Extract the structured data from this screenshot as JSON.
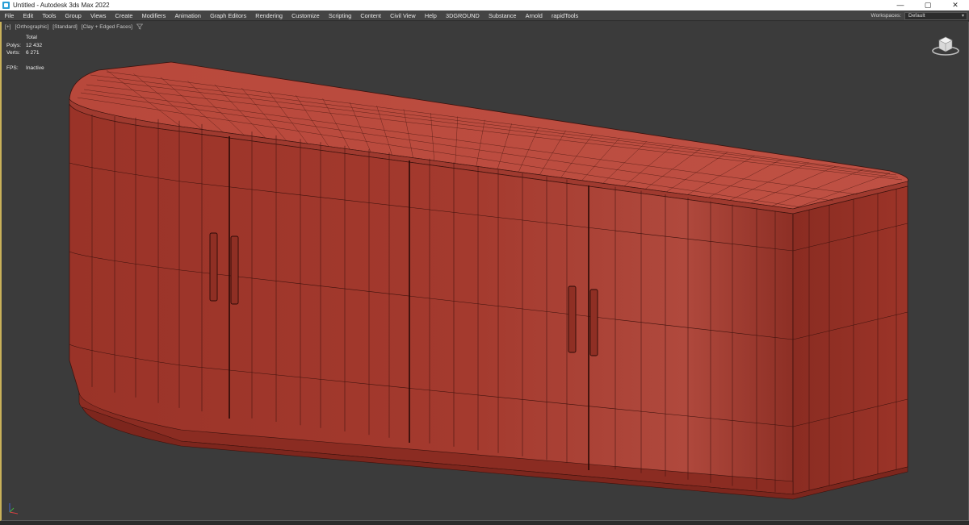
{
  "window": {
    "title": "Untitled - Autodesk 3ds Max 2022"
  },
  "window_controls": {
    "minimize": "—",
    "restore": "▢",
    "close": "✕"
  },
  "menu": {
    "items": [
      "File",
      "Edit",
      "Tools",
      "Group",
      "Views",
      "Create",
      "Modifiers",
      "Animation",
      "Graph Editors",
      "Rendering",
      "Customize",
      "Scripting",
      "Content",
      "Civil View",
      "Help",
      "3DGROUND",
      "Substance",
      "Arnold",
      "rapidTools"
    ],
    "workspaces_label": "Workspaces:",
    "workspaces_value": "Default"
  },
  "viewport": {
    "label_plus": "[+]",
    "label_view": "[Orthographic]",
    "label_style": "[Standard]",
    "label_shading": "[Clay + Edged Faces]",
    "stats": {
      "header": "Total",
      "polys_label": "Polys:",
      "polys_value": "12 432",
      "verts_label": "Verts:",
      "verts_value": "6 271",
      "fps_label": "FPS:",
      "fps_value": "Inactive"
    }
  },
  "icons": {
    "app": "3ds-max-icon",
    "filter": "filter-icon",
    "viewcube": "viewcube-icon",
    "axis": "axis-tripod-icon"
  },
  "colors": {
    "menubar": "#444444",
    "viewport_bg": "#3b3b3b",
    "viewport_border": "#c9b15a",
    "model_fill": "#a63a2e",
    "model_wire": "#3d120d"
  }
}
